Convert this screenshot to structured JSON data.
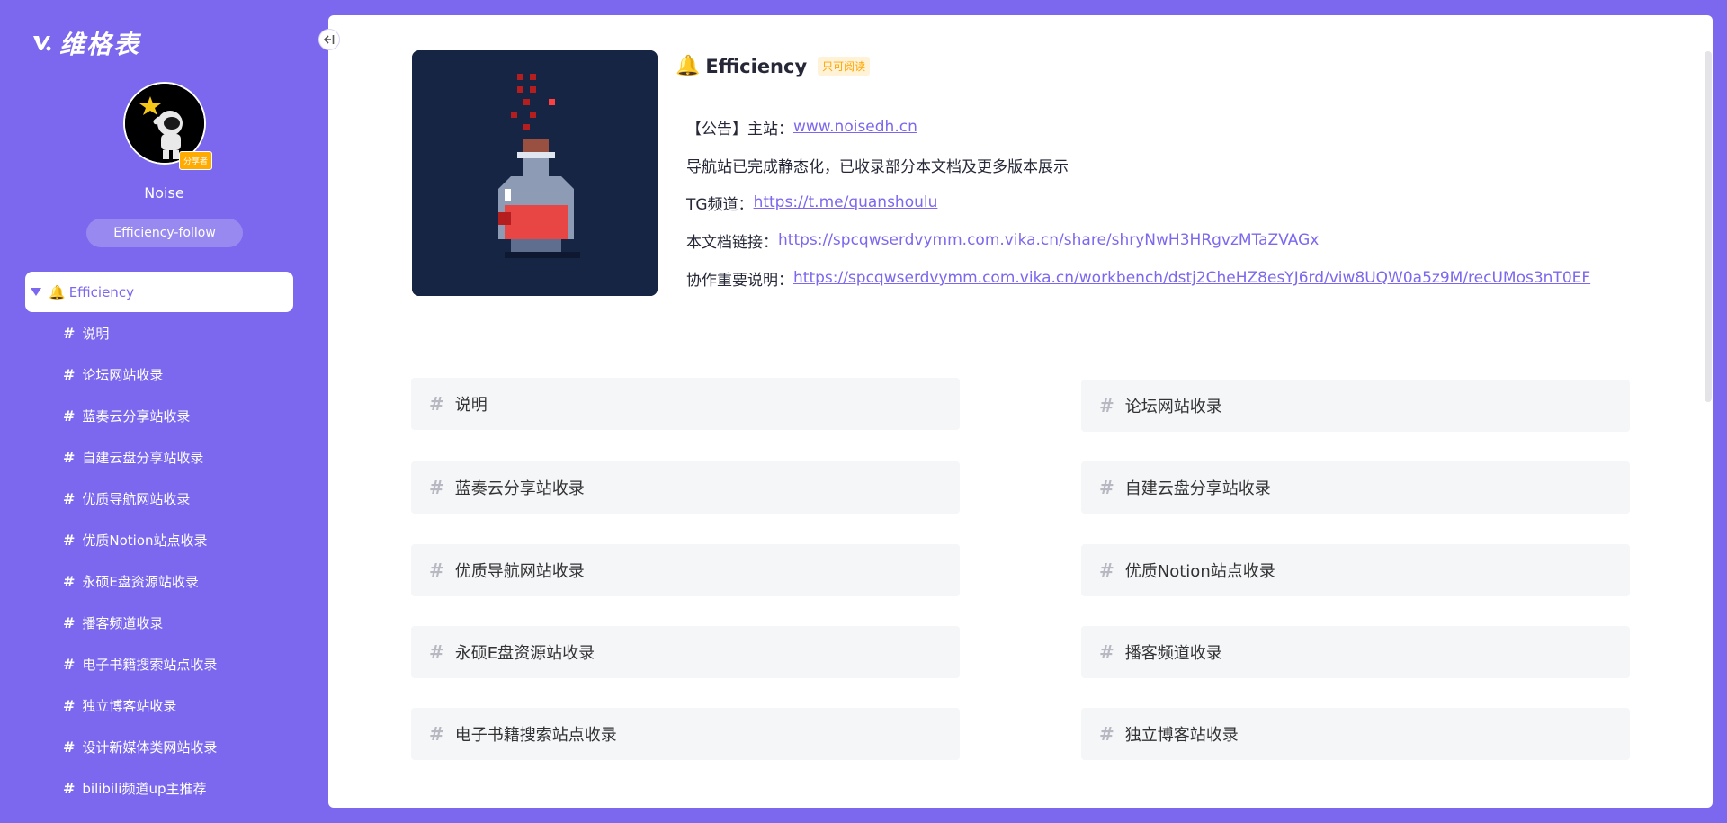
{
  "app": {
    "name": "维格表"
  },
  "profile": {
    "username": "Noise",
    "badge": "分享者",
    "follow_label": "Efficiency-follow"
  },
  "sidebar": {
    "root": {
      "icon": "bell-icon",
      "label": "Efficiency"
    },
    "items": [
      {
        "label": "说明"
      },
      {
        "label": "论坛网站收录"
      },
      {
        "label": "蓝奏云分享站收录"
      },
      {
        "label": "自建云盘分享站收录"
      },
      {
        "label": "优质导航网站收录"
      },
      {
        "label": "优质Notion站点收录"
      },
      {
        "label": "永硕E盘资源站收录"
      },
      {
        "label": "播客频道收录"
      },
      {
        "label": "电子书籍搜索站点收录"
      },
      {
        "label": "独立博客站收录"
      },
      {
        "label": "设计新媒体类网站收录"
      },
      {
        "label": "bilibili频道up主推荐"
      }
    ]
  },
  "main": {
    "title": "Efficiency",
    "readonly_tag": "只可阅读",
    "notes": [
      {
        "prefix": "【公告】主站：",
        "link": "www.noisedh.cn"
      },
      {
        "prefix": "导航站已完成静态化，已收录部分本文档及更多版本展示",
        "link": ""
      },
      {
        "prefix": "TG频道：",
        "link": "https://t.me/quanshoulu"
      },
      {
        "prefix": "本文档链接：",
        "link": "https://spcqwserdvymm.com.vika.cn/share/shryNwH3HRgvzMTaZVAGx"
      },
      {
        "prefix": "协作重要说明：",
        "link": "https://spcqwserdvymm.com.vika.cn/workbench/dstj2CheHZ8esYJ6rd/viw8UQW0a5z9M/recUMos3nT0EF"
      }
    ],
    "cards": [
      {
        "label": "说明"
      },
      {
        "label": "论坛网站收录"
      },
      {
        "label": "蓝奏云分享站收录"
      },
      {
        "label": "自建云盘分享站收录"
      },
      {
        "label": "优质导航网站收录"
      },
      {
        "label": "优质Notion站点收录"
      },
      {
        "label": "永硕E盘资源站收录"
      },
      {
        "label": "播客频道收录"
      },
      {
        "label": "电子书籍搜索站点收录"
      },
      {
        "label": "独立博客站收录"
      }
    ]
  },
  "colors": {
    "brand": "#7b68ee",
    "cover_bg": "#172545",
    "tag": "#ffa500"
  }
}
